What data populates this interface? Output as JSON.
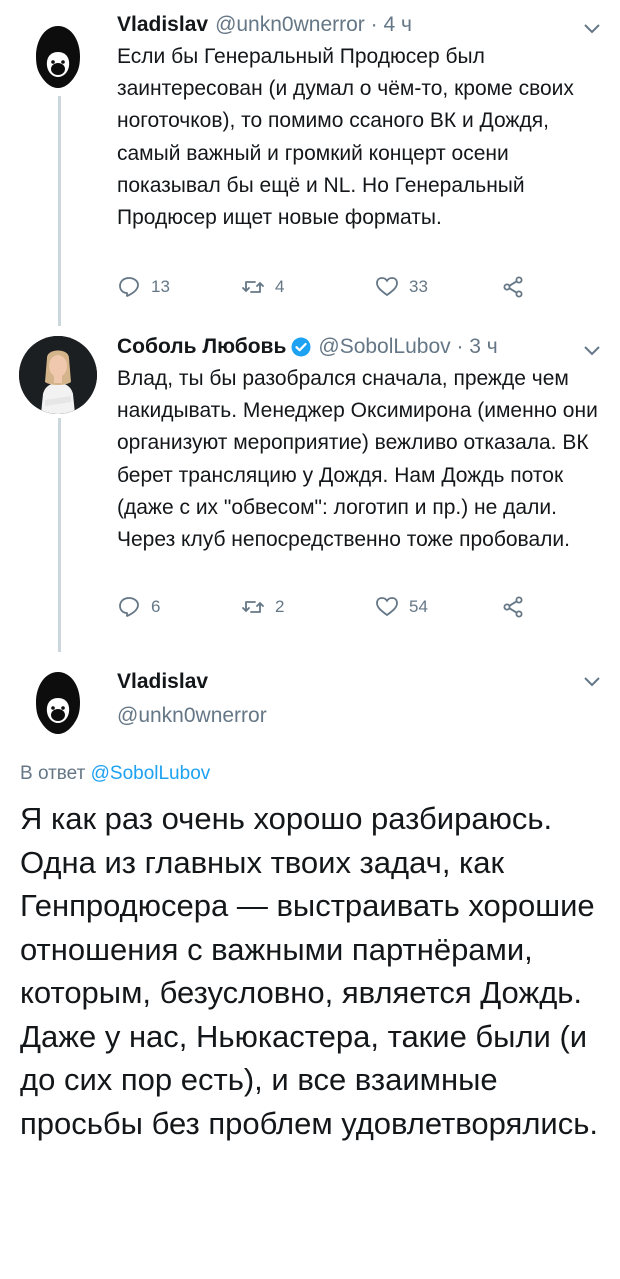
{
  "colors": {
    "text": "#14171a",
    "secondary": "#657786",
    "accent": "#1da1f2",
    "thread_line": "#ccd6dd"
  },
  "tweet1": {
    "name": "Vladislav",
    "meta": "@unkn0wnerror · 4 ч",
    "text": "Если бы Генеральный Продюсер был заинтересован (и думал о чём-то, кроме своих ноготочков), то помимо ссаного ВК и Дождя,  самый важный и громкий концерт осени показывал бы ещё и NL. Но Генеральный Продюсер ищет новые форматы.",
    "replies": "13",
    "retweets": "4",
    "likes": "33"
  },
  "tweet2": {
    "name": "Соболь Любовь",
    "meta": "@SobolLubov · 3 ч",
    "text": "Влад, ты бы разобрался сначала, прежде чем накидывать. Менеджер Оксимирона (именно они организуют мероприятие) вежливо отказала. ВК берет трансляцию у Дождя. Нам Дождь поток (даже с их \"обвесом\": логотип и пр.) не дали. Через клуб непосредственно тоже пробовали.",
    "replies": "6",
    "retweets": "2",
    "likes": "54"
  },
  "main_tweet": {
    "name": "Vladislav",
    "handle": "@unkn0wnerror",
    "reply_prefix": "В ответ",
    "reply_handle": "@SobolLubov",
    "text": "Я как раз очень хорошо разбираюсь.\nОдна из главных твоих задач, как Генпродюсера — выстраивать хорошие отношения с важными партнёрами, которым, безусловно, является Дождь.\nДаже у нас, Ньюкастера, такие были (и до сих пор есть), и все взаимные просьбы без проблем удовлетворялись."
  },
  "icons": [
    "anonymous-avatar",
    "profile-photo",
    "verified-badge",
    "chevron-down-icon",
    "reply-icon",
    "retweet-icon",
    "like-icon",
    "share-icon"
  ]
}
